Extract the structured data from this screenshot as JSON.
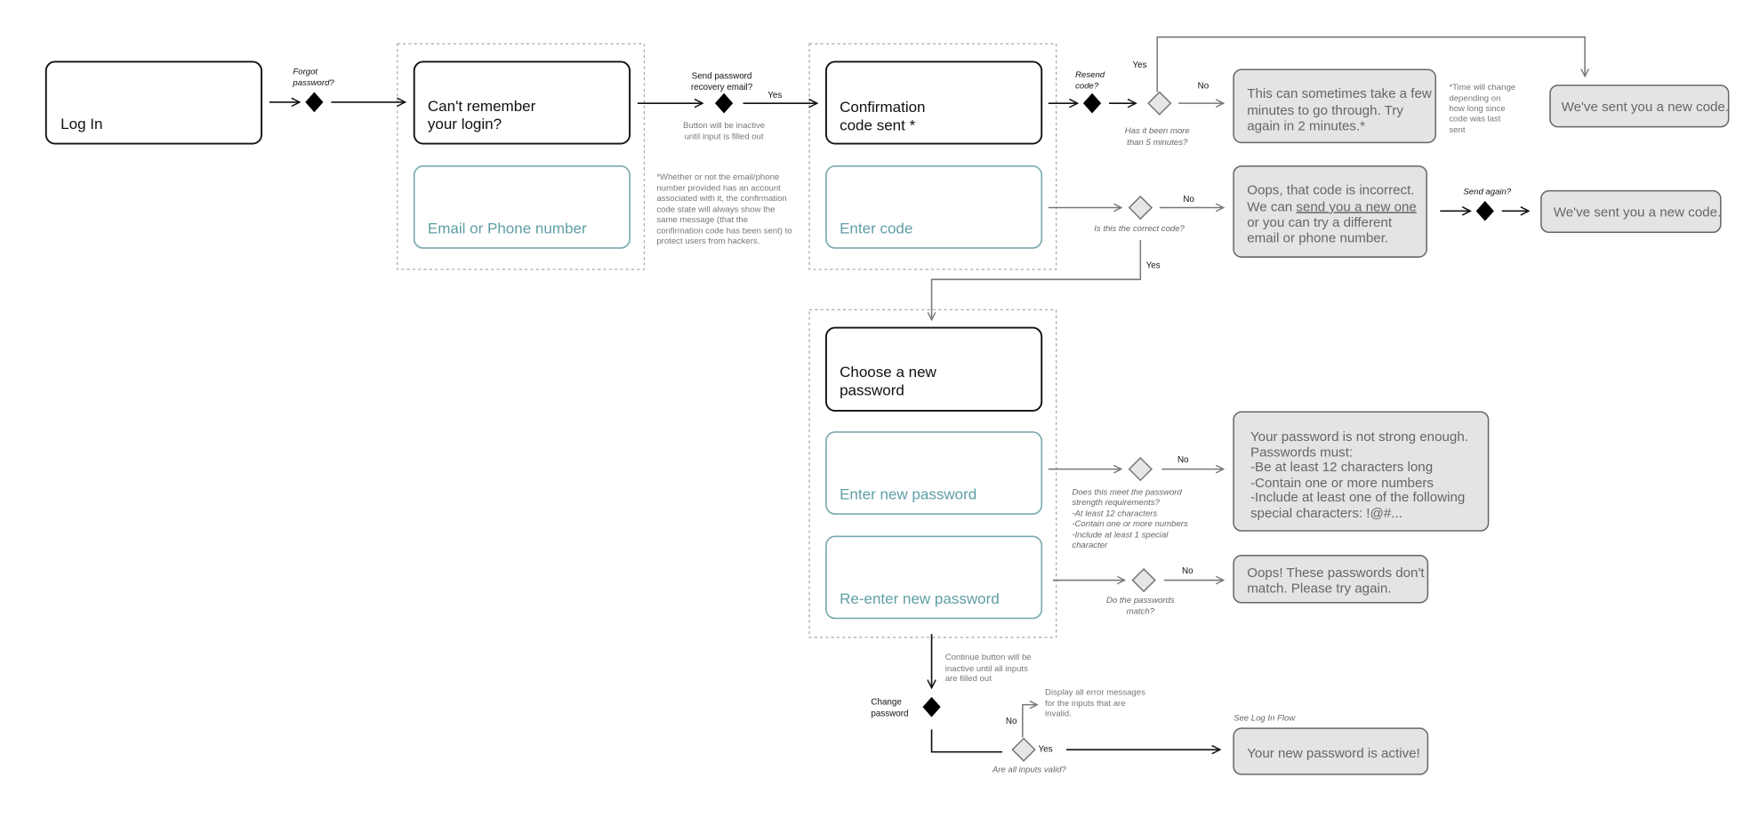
{
  "colors": {
    "teal_text": "#5f9ea5",
    "teal_border": "#7aa9ae",
    "message_fill": "#e4e4e4",
    "decision_black": "#000000",
    "decision_gray": "#e6e6e6"
  },
  "login": {
    "title": "Log In",
    "decision": [
      "Forgot",
      "password?"
    ]
  },
  "forgot": {
    "title": [
      "Can't remember",
      "your login?"
    ],
    "input_placeholder": "Email or Phone number",
    "decision": [
      "Send password",
      "recovery email?"
    ],
    "yes": "Yes",
    "hint": [
      "Button will be inactive",
      "until input is filled out"
    ],
    "footnote": [
      "*Whether or not the email/phone",
      "number provided has an account",
      "associated with it, the confirmation",
      "code state will always show the",
      "same message (that the",
      "confirmation code has been sent) to",
      "protect users from hackers."
    ]
  },
  "confirm": {
    "title": [
      "Confirmation",
      "code sent *"
    ],
    "input_placeholder": "Enter code",
    "resend_decision": [
      "Resend",
      "code?"
    ],
    "time_question": [
      "Has it been more",
      "than 5 minutes?"
    ],
    "yes": "Yes",
    "no": "No",
    "wait_message": [
      "This can sometimes take a few",
      "minutes to go through. Try",
      "again in 2 minutes.*"
    ],
    "time_note": [
      "*Time will change",
      "depending on",
      "how long since",
      "code was last",
      "sent"
    ],
    "sent_message": "We've sent you a new code.",
    "code_question": "Is this the correct code?",
    "code_no": "No",
    "code_yes": "Yes",
    "incorrect_message": {
      "line1": "Oops, that code is incorrect.",
      "line2_prefix": "We can ",
      "line2_link": "send you a new one",
      "line3": "or you can try a different",
      "line4": "email or phone number."
    },
    "send_again": "Send again?",
    "sent_again_message": "We've sent you a new code."
  },
  "new_password": {
    "title": [
      "Choose a new",
      "password"
    ],
    "input1_placeholder": "Enter new password",
    "input2_placeholder": "Re-enter new password",
    "strength_question": [
      "Does this meet the password",
      "strength requirements?",
      "-At least 12 characters",
      "-Contain one or more numbers",
      "-Include at least 1 special",
      "character"
    ],
    "strength_no": "No",
    "strength_message": [
      "Your password is not strong enough.",
      "Passwords must:",
      "-Be at least 12 characters long",
      "-Contain one or more numbers",
      "-Include at least one of the following",
      "special characters: !@#..."
    ],
    "match_question": [
      "Do the passwords",
      "match?"
    ],
    "match_no": "No",
    "match_message": [
      "Oops! These passwords don't",
      "match. Please try again."
    ],
    "continue_note": [
      "Continue button will be",
      "inactive until all inputs",
      "are filled out"
    ],
    "change_decision": [
      "Change",
      "password"
    ],
    "valid_question": "Are all inputs valid?",
    "valid_no": "No",
    "valid_yes": "Yes",
    "error_note": [
      "Display all error messages",
      "for the inputs that are",
      "invalid."
    ],
    "see_flow": "See Log In Flow",
    "success_message": "Your new password is active!"
  }
}
